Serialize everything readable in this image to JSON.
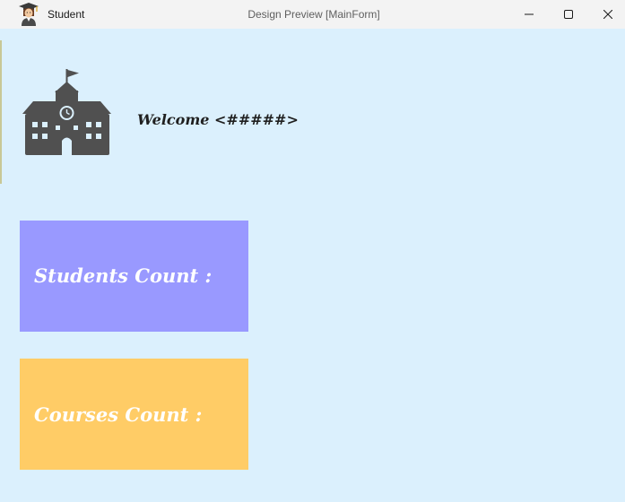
{
  "titlebar": {
    "app_title": "Student",
    "caption": "Design Preview [MainForm]",
    "app_icon": "student-avatar-icon",
    "controls": {
      "minimize": "minimize-icon",
      "maximize": "maximize-icon",
      "close": "close-icon"
    }
  },
  "header": {
    "logo_icon": "school-building-icon",
    "welcome_text": "Welcome <#####>"
  },
  "cards": {
    "students": {
      "label": "Students Count :",
      "color": "#9999ff"
    },
    "courses": {
      "label": "Courses Count :",
      "color": "#ffcc66"
    }
  },
  "colors": {
    "background": "#dbf0fd",
    "titlebar": "#f3f3f3",
    "logo": "#505050"
  }
}
